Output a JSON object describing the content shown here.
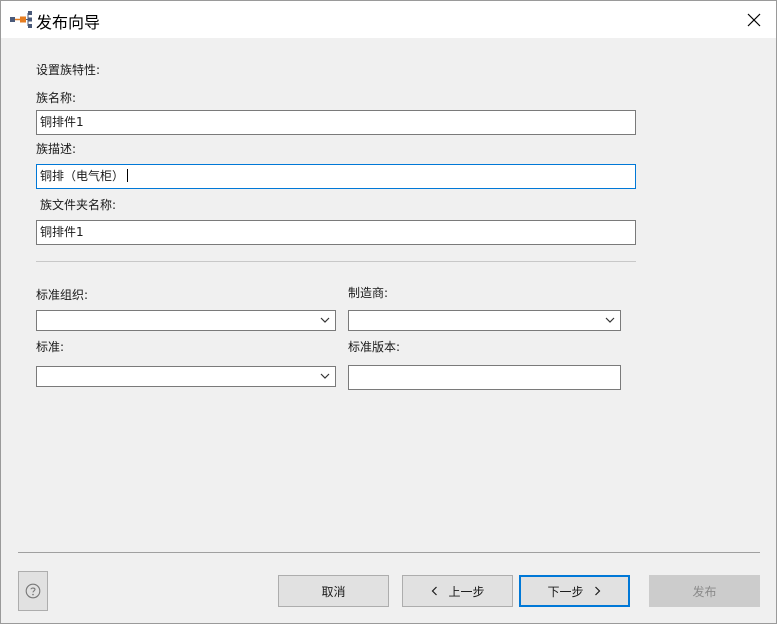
{
  "window": {
    "title": "发布向导"
  },
  "section": {
    "heading": "设置族特性:"
  },
  "fields": {
    "family_name": {
      "label": "族名称:",
      "value": "铜排件1"
    },
    "family_desc": {
      "label": "族描述:",
      "value": "铜排（电气柜）"
    },
    "folder_name": {
      "label": "族文件夹名称:",
      "value": "铜排件1"
    }
  },
  "props": {
    "standard_org": {
      "label": "标准组织:",
      "value": ""
    },
    "manufacturer": {
      "label": "制造商:",
      "value": ""
    },
    "standard": {
      "label": "标准:",
      "value": ""
    },
    "standard_version": {
      "label": "标准版本:",
      "value": ""
    }
  },
  "footer": {
    "help_icon": "question-circle-icon",
    "cancel": "取消",
    "prev": "上一步",
    "next": "下一步",
    "publish": "发布"
  },
  "colors": {
    "focus": "#0078d7",
    "accent": "#e67e22"
  }
}
